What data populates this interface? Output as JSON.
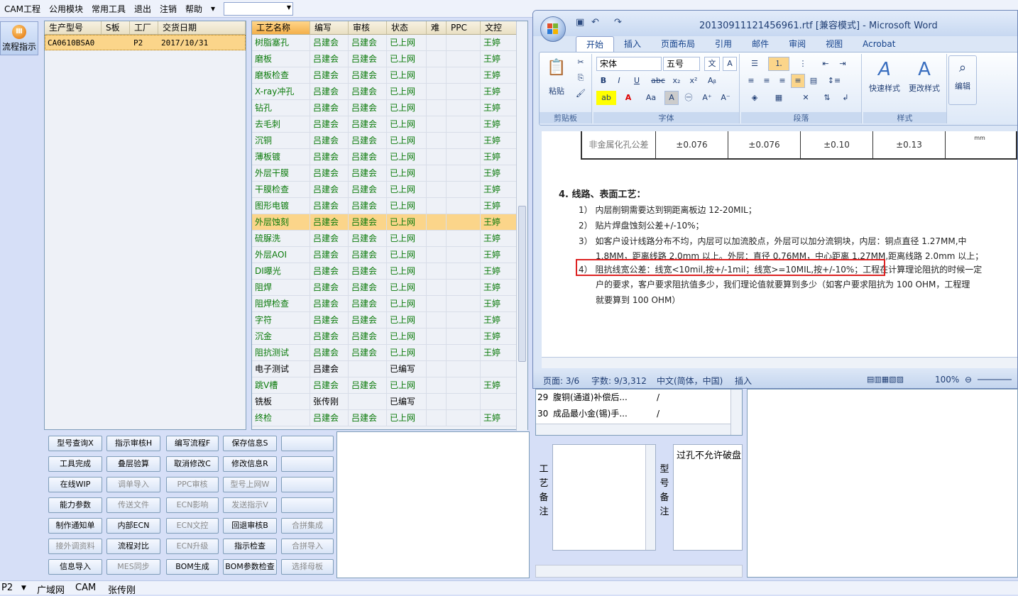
{
  "menubar": {
    "items": [
      "CAM工程",
      "公用模块",
      "常用工具",
      "退出",
      "注销",
      "帮助"
    ],
    "dropdown_value": ""
  },
  "flow_button": {
    "label": "流程指示"
  },
  "grid1": {
    "headers": [
      "生产型号",
      "S板",
      "工厂",
      "交货日期"
    ],
    "row": [
      "CA0610BSA0",
      "",
      "P2",
      "2017/10/31"
    ]
  },
  "grid2": {
    "headers": [
      "工艺名称",
      "编写",
      "审核",
      "状态",
      "难",
      "PPC",
      "文控"
    ],
    "rows": [
      [
        "树脂塞孔",
        "吕建会",
        "吕建会",
        "已上网",
        "",
        "",
        "王婷"
      ],
      [
        "磨板",
        "吕建会",
        "吕建会",
        "已上网",
        "",
        "",
        "王婷"
      ],
      [
        "磨板检查",
        "吕建会",
        "吕建会",
        "已上网",
        "",
        "",
        "王婷"
      ],
      [
        "X-ray冲孔",
        "吕建会",
        "吕建会",
        "已上网",
        "",
        "",
        "王婷"
      ],
      [
        "钻孔",
        "吕建会",
        "吕建会",
        "已上网",
        "",
        "",
        "王婷"
      ],
      [
        "去毛刺",
        "吕建会",
        "吕建会",
        "已上网",
        "",
        "",
        "王婷"
      ],
      [
        "沉铜",
        "吕建会",
        "吕建会",
        "已上网",
        "",
        "",
        "王婷"
      ],
      [
        "薄板镀",
        "吕建会",
        "吕建会",
        "已上网",
        "",
        "",
        "王婷"
      ],
      [
        "外层干膜",
        "吕建会",
        "吕建会",
        "已上网",
        "",
        "",
        "王婷"
      ],
      [
        "干膜检查",
        "吕建会",
        "吕建会",
        "已上网",
        "",
        "",
        "王婷"
      ],
      [
        "图形电镀",
        "吕建会",
        "吕建会",
        "已上网",
        "",
        "",
        "王婷"
      ],
      [
        "外层蚀刻",
        "吕建会",
        "吕建会",
        "已上网",
        "",
        "",
        "王婷"
      ],
      [
        "硫脲洗",
        "吕建会",
        "吕建会",
        "已上网",
        "",
        "",
        "王婷"
      ],
      [
        "外层AOI",
        "吕建会",
        "吕建会",
        "已上网",
        "",
        "",
        "王婷"
      ],
      [
        "DI曝光",
        "吕建会",
        "吕建会",
        "已上网",
        "",
        "",
        "王婷"
      ],
      [
        "阻焊",
        "吕建会",
        "吕建会",
        "已上网",
        "",
        "",
        "王婷"
      ],
      [
        "阻焊检查",
        "吕建会",
        "吕建会",
        "已上网",
        "",
        "",
        "王婷"
      ],
      [
        "字符",
        "吕建会",
        "吕建会",
        "已上网",
        "",
        "",
        "王婷"
      ],
      [
        "沉金",
        "吕建会",
        "吕建会",
        "已上网",
        "",
        "",
        "王婷"
      ],
      [
        "阻抗测试",
        "吕建会",
        "吕建会",
        "已上网",
        "",
        "",
        "王婷"
      ],
      [
        "电子测试",
        "吕建会",
        "",
        "已编写",
        "",
        "",
        ""
      ],
      [
        "跳V槽",
        "吕建会",
        "吕建会",
        "已上网",
        "",
        "",
        "王婷"
      ],
      [
        "铣板",
        "张传刚",
        "",
        "已编写",
        "",
        "",
        ""
      ],
      [
        "终检",
        "吕建会",
        "吕建会",
        "已上网",
        "",
        "",
        "王婷"
      ]
    ],
    "selected_index": 11,
    "black_rows": [
      20,
      22
    ]
  },
  "buttons": [
    [
      "型号查询X",
      "指示审核H",
      "编写流程F",
      "保存信息S",
      ""
    ],
    [
      "工具完成",
      "叠层验算",
      "取消修改C",
      "修改信息R",
      ""
    ],
    [
      "在线WIP",
      "调单导入",
      "PPC审核",
      "型号上网W",
      ""
    ],
    [
      "能力参数",
      "传送文件",
      "ECN影响",
      "发送指示V",
      ""
    ],
    [
      "制作通知单",
      "内部ECN",
      "ECN文控",
      "回退审核B",
      "合拼集成"
    ],
    [
      "接外调资料",
      "流程对比",
      "ECN升级",
      "指示检查",
      "合拼导入"
    ],
    [
      "信息导入",
      "MES同步",
      "BOM生成",
      "BOM参数检查",
      "选择母板"
    ]
  ],
  "disabled_buttons": [
    "调单导入",
    "PPC审核",
    "型号上网W",
    "传送文件",
    "ECN影响",
    "发送指示V",
    "合拼集成",
    "接外调资料",
    "ECN文控",
    "ECN升级",
    "合拼导入",
    "MES同步",
    "选择母板"
  ],
  "word": {
    "title": "20130911121456961.rtf [兼容模式] - Microsoft Word",
    "tabs": [
      "开始",
      "插入",
      "页面布局",
      "引用",
      "邮件",
      "审阅",
      "视图",
      "Acrobat"
    ],
    "groups": {
      "clipboard": "剪贴板",
      "paste": "粘贴",
      "font": "字体",
      "paragraph": "段落",
      "styles": "样式",
      "quick_styles": "快速样式",
      "change_styles": "更改样式",
      "editing": "编辑"
    },
    "font_name": "宋体",
    "font_size": "五号",
    "table_row": [
      "非金属化孔公差",
      "±0.076",
      "±0.076",
      "±0.10",
      "±0.13",
      "mm"
    ],
    "lines": [
      "4.  线路、表面工艺：",
      "1） 内层削铜需要达到铜距离板边 12-20MIL；",
      "2） 贴片焊盘蚀刻公差+/-10%；",
      "3） 如客户设计线路分布不均，内层可以加流胶点，外层可以加分流铜块，内层：铜点直径 1.27MM,中",
      "1.8MM，距离线路 2.0mm 以上。外层：直径 0.76MM，中心距离 1.27MM,距离线路 2.0mm 以上；",
      "4） 阻抗线宽公差：线宽<10mil,按+/-1mil；线宽>=10MIL,按+/-10%；工程在计算理论阻抗的时候一定",
      "户的要求，客户要求阻抗值多少，我们理论值就要算到多少（如客户要求阻抗为 100 OHM，工程理",
      "就要算到 100 OHM）"
    ],
    "status": {
      "page": "页面: 3/6",
      "words": "字数: 9/3,312",
      "lang": "中文(简体，中国)",
      "mode": "插入",
      "zoom": "100%"
    }
  },
  "midlist": {
    "rows": [
      [
        "29",
        "腹铜(通道)补偿后...",
        "/"
      ],
      [
        "30",
        "成品最小金(锡)手...",
        "/"
      ]
    ]
  },
  "notes": {
    "left_label": "工艺备注",
    "right_label": "型号备注",
    "right_text": "过孔不允许破盘"
  },
  "statusbar": {
    "items": [
      "P2",
      "广域网",
      "CAM",
      "张传刚"
    ]
  },
  "colors": {
    "accent": "#fbd58a",
    "green": "#0a7a0a",
    "highlight_box": "#d22"
  }
}
